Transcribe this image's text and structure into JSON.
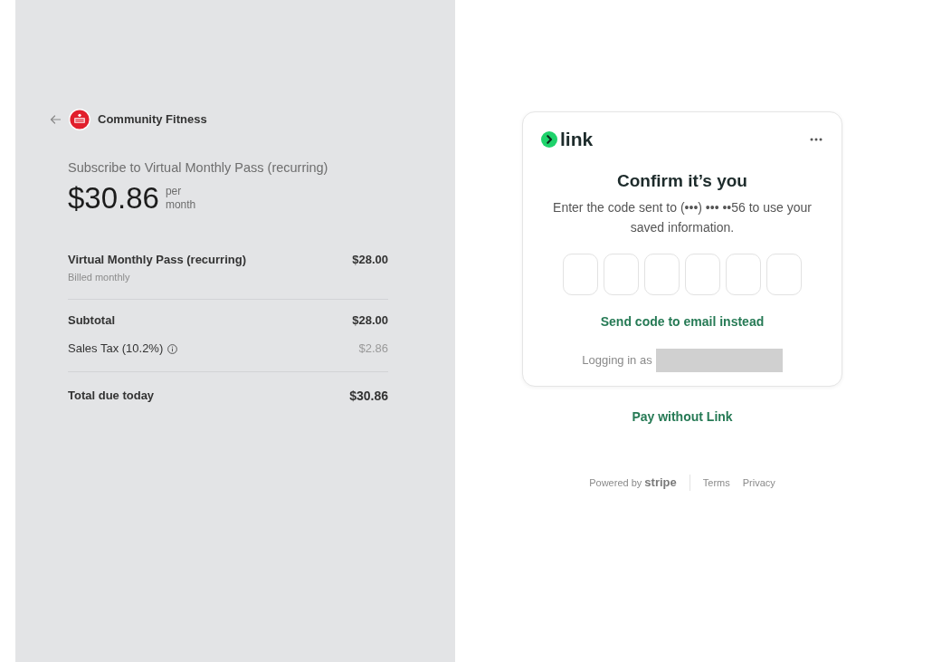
{
  "merchant": {
    "name": "Community Fitness"
  },
  "summary": {
    "title": "Subscribe to Virtual Monthly Pass (recurring)",
    "price": "$30.86",
    "period": "per month"
  },
  "line_items": [
    {
      "name": "Virtual Monthly Pass (recurring)",
      "note": "Billed monthly",
      "amount": "$28.00"
    }
  ],
  "totals": [
    {
      "kind": "subtotal",
      "label": "Subtotal",
      "amount": "$28.00"
    },
    {
      "kind": "tax",
      "label": "Sales Tax (10.2%)",
      "amount": "$2.86"
    },
    {
      "kind": "total",
      "label": "Total due today",
      "amount": "$30.86"
    }
  ],
  "link_card": {
    "brand": "link",
    "heading": "Confirm it’s you",
    "message": "Enter the code sent to (•••) ••• ••56 to use your saved information.",
    "code_digits": [
      {
        "focused": false
      },
      {
        "focused": false
      },
      {
        "focused": false
      },
      {
        "focused": false
      },
      {
        "focused": false
      },
      {
        "focused": false
      }
    ],
    "alt_action": "Send code to email instead",
    "login_label": "Logging in as"
  },
  "secondary_action": "Pay without Link",
  "footer": {
    "powered_by": "Powered by **stripe**",
    "links": [
      "Terms",
      "Privacy"
    ]
  }
}
